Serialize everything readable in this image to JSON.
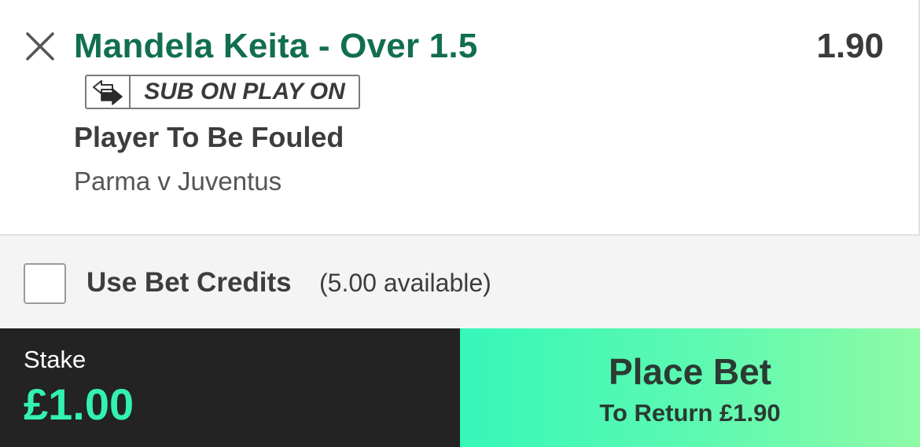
{
  "selection": {
    "title": "Mandela Keita - Over 1.5",
    "odds": "1.90",
    "badge_label": "SUB ON PLAY ON",
    "market": "Player To Be Fouled",
    "event": "Parma v Juventus"
  },
  "credits": {
    "label": "Use Bet Credits",
    "available": "(5.00 available)",
    "checked": false
  },
  "stake": {
    "label": "Stake",
    "value": "£1.00"
  },
  "place_bet": {
    "label": "Place Bet",
    "return_text": "To Return £1.90"
  },
  "icons": {
    "close": "close-icon",
    "sub_swap": "substitution-swap-icon"
  },
  "colors": {
    "selection_green": "#126e51",
    "stake_accent": "#33f2b0",
    "place_bet_gradient_start": "#36f7b9",
    "place_bet_gradient_end": "#8efba6",
    "dark_panel": "#232323"
  }
}
